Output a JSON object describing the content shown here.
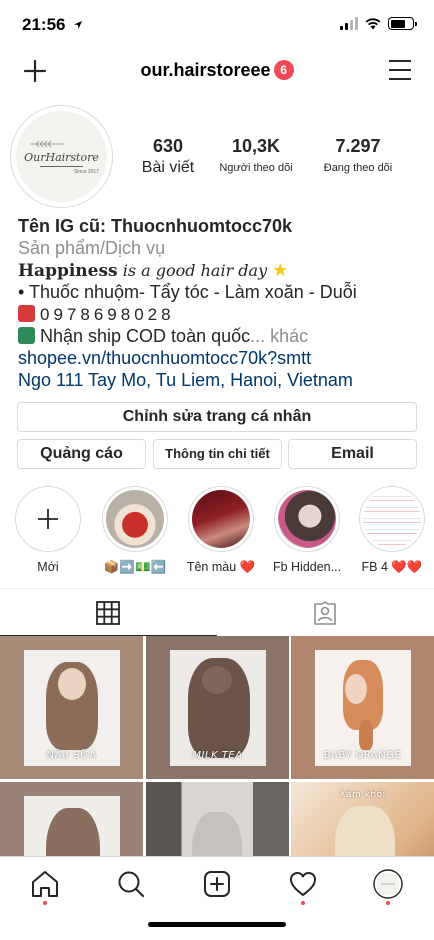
{
  "status_bar": {
    "time": "21:56"
  },
  "header": {
    "username": "our.hairstoreee",
    "notification_count": "6"
  },
  "avatar": {
    "logo_text": "OurHairstore",
    "logo_sub": "Since 2017"
  },
  "stats": [
    {
      "value": "630",
      "label": "Bài viết"
    },
    {
      "value": "10,3K",
      "label": "Người theo dõi"
    },
    {
      "value": "7.297",
      "label": "Đang theo dõi"
    }
  ],
  "bio": {
    "name": "Tên IG cũ: Thuocnhuomtocc70k",
    "category": "Sản phẩm/Dịch vụ",
    "line1_bold": "Happiness",
    "line1_italic": " is a good hair day ",
    "line2": "• Thuốc nhuộm- Tẩy tóc - Làm xoăn - Duỗi",
    "phone": "0978698028",
    "line4": " Nhận ship COD toàn quốc",
    "more": "... khác",
    "link": "shopee.vn/thuocnhuomtocc70k?smtt",
    "address": "Ngo 111 Tay Mo, Tu Liem, Hanoi, Vietnam"
  },
  "buttons": {
    "edit_profile": "Chỉnh sửa trang cá nhân",
    "ads": "Quảng cáo",
    "details": "Thông tin chi tiết",
    "email": "Email"
  },
  "highlights": [
    {
      "label": "Mới"
    },
    {
      "label": "📦➡️💵⬅️"
    },
    {
      "label": "Tên màu ❤️"
    },
    {
      "label": "Fb Hidden..."
    },
    {
      "label": "FB 4 ❤️❤️"
    }
  ],
  "grid": [
    {
      "caption": "NÂU SỮA"
    },
    {
      "caption": "MILK TEA"
    },
    {
      "caption": "BABY ORANGE"
    },
    {
      "caption": ""
    },
    {
      "caption": ""
    },
    {
      "caption": "Xám khói"
    }
  ],
  "colors": {
    "accent_red": "#ed4956",
    "link_blue": "#00376b",
    "muted_text": "#8e8e8e",
    "border": "#dbdbdb"
  },
  "icons": [
    "new-post-icon",
    "menu-icon",
    "grid-icon",
    "tagged-icon",
    "home-icon",
    "search-icon",
    "create-icon",
    "heart-icon",
    "profile-icon"
  ]
}
